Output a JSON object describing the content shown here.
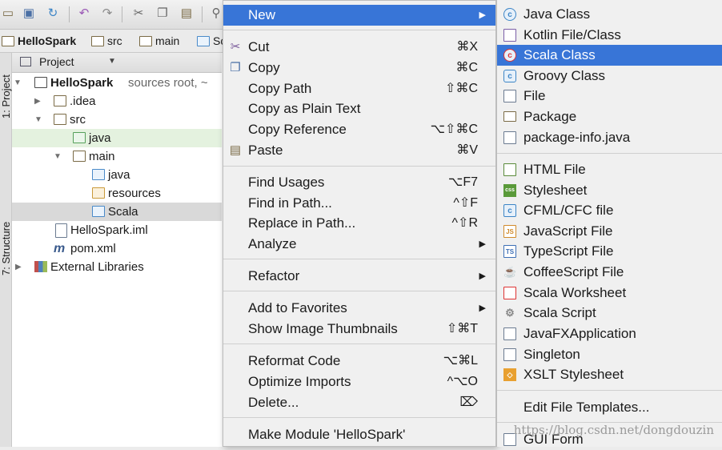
{
  "toolbar": {
    "icons": [
      "folder-icon",
      "save-icon",
      "sync-icon",
      "undo-icon",
      "redo-icon",
      "cut-icon",
      "copy-icon",
      "paste-icon",
      "find-icon"
    ]
  },
  "breadcrumb": {
    "items": [
      {
        "label": "HelloSpark",
        "bold": true
      },
      {
        "label": "src"
      },
      {
        "label": "main"
      },
      {
        "label": "Sc"
      }
    ]
  },
  "side_tabs": {
    "project": "1: Project",
    "structure": "7: Structure"
  },
  "project_panel": {
    "title": "Project",
    "tree": [
      {
        "label": "HelloSpark",
        "suffix": "sources root, ~",
        "bold": true,
        "depth": 0,
        "arrow": "down",
        "icon": "module"
      },
      {
        "label": ".idea",
        "depth": 1,
        "arrow": "right",
        "icon": "folder"
      },
      {
        "label": "src",
        "depth": 1,
        "arrow": "down",
        "icon": "folder"
      },
      {
        "label": "java",
        "depth": 2,
        "icon": "folder-green",
        "highlight": "green"
      },
      {
        "label": "main",
        "depth": 2,
        "arrow": "down",
        "icon": "folder"
      },
      {
        "label": "java",
        "depth": 3,
        "icon": "folder-blue"
      },
      {
        "label": "resources",
        "depth": 3,
        "icon": "folder-res"
      },
      {
        "label": "Scala",
        "depth": 3,
        "icon": "folder-blue",
        "highlight": "gray"
      },
      {
        "label": "HelloSpark.iml",
        "depth": 2,
        "icon": "iml"
      },
      {
        "label": "pom.xml",
        "depth": 2,
        "icon": "maven"
      },
      {
        "label": "External Libraries",
        "depth": 0,
        "arrow": "right",
        "icon": "libraries"
      }
    ]
  },
  "context_menu": {
    "items": [
      {
        "label": "New",
        "submenu": true,
        "selected": true
      },
      {
        "sep": true
      },
      {
        "label": "Cut",
        "shortcut": "⌘X",
        "icon": "cut-icon"
      },
      {
        "label": "Copy",
        "shortcut": "⌘C",
        "icon": "copy-icon"
      },
      {
        "label": "Copy Path",
        "shortcut": "⇧⌘C"
      },
      {
        "label": "Copy as Plain Text"
      },
      {
        "label": "Copy Reference",
        "shortcut": "⌥⇧⌘C"
      },
      {
        "label": "Paste",
        "shortcut": "⌘V",
        "icon": "paste-icon"
      },
      {
        "sep": true
      },
      {
        "label": "Find Usages",
        "shortcut": "⌥F7"
      },
      {
        "label": "Find in Path...",
        "shortcut": "^⇧F"
      },
      {
        "label": "Replace in Path...",
        "shortcut": "^⇧R"
      },
      {
        "label": "Analyze",
        "submenu": true
      },
      {
        "sep": true
      },
      {
        "label": "Refactor",
        "submenu": true
      },
      {
        "sep": true
      },
      {
        "label": "Add to Favorites",
        "submenu": true
      },
      {
        "label": "Show Image Thumbnails",
        "shortcut": "⇧⌘T"
      },
      {
        "sep": true
      },
      {
        "label": "Reformat Code",
        "shortcut": "⌥⌘L"
      },
      {
        "label": "Optimize Imports",
        "shortcut": "^⌥O"
      },
      {
        "label": "Delete...",
        "shortcut": "⌦"
      },
      {
        "sep": true
      },
      {
        "label": "Make Module 'HelloSpark'"
      }
    ]
  },
  "new_submenu": {
    "items": [
      {
        "label": "Java Class",
        "icon": "java-class-icon"
      },
      {
        "label": "Kotlin File/Class",
        "icon": "kotlin-icon"
      },
      {
        "label": "Scala Class",
        "icon": "scala-class-icon",
        "selected": true
      },
      {
        "label": "Groovy Class",
        "icon": "groovy-class-icon"
      },
      {
        "label": "File",
        "icon": "file-icon"
      },
      {
        "label": "Package",
        "icon": "package-icon"
      },
      {
        "label": "package-info.java",
        "icon": "java-file-icon"
      },
      {
        "sep": true
      },
      {
        "label": "HTML File",
        "icon": "html-icon"
      },
      {
        "label": "Stylesheet",
        "icon": "css-icon"
      },
      {
        "label": "CFML/CFC file",
        "icon": "cfml-icon"
      },
      {
        "label": "JavaScript File",
        "icon": "js-icon"
      },
      {
        "label": "TypeScript File",
        "icon": "ts-icon"
      },
      {
        "label": "CoffeeScript File",
        "icon": "coffee-icon"
      },
      {
        "label": "Scala Worksheet",
        "icon": "scala-worksheet-icon"
      },
      {
        "label": "Scala Script",
        "icon": "scala-script-icon"
      },
      {
        "label": "JavaFXApplication",
        "icon": "javafx-icon"
      },
      {
        "label": "Singleton",
        "icon": "singleton-icon"
      },
      {
        "label": "XSLT Stylesheet",
        "icon": "xslt-icon"
      },
      {
        "sep": true
      },
      {
        "label": "Edit File Templates..."
      },
      {
        "sep": true
      },
      {
        "label": "GUI Form",
        "icon": "gui-form-icon"
      }
    ]
  },
  "watermark": "https://blog.csdn.net/dongdouzin",
  "colors": {
    "selection": "#3875d7",
    "menu_bg": "#f0f0f0"
  }
}
